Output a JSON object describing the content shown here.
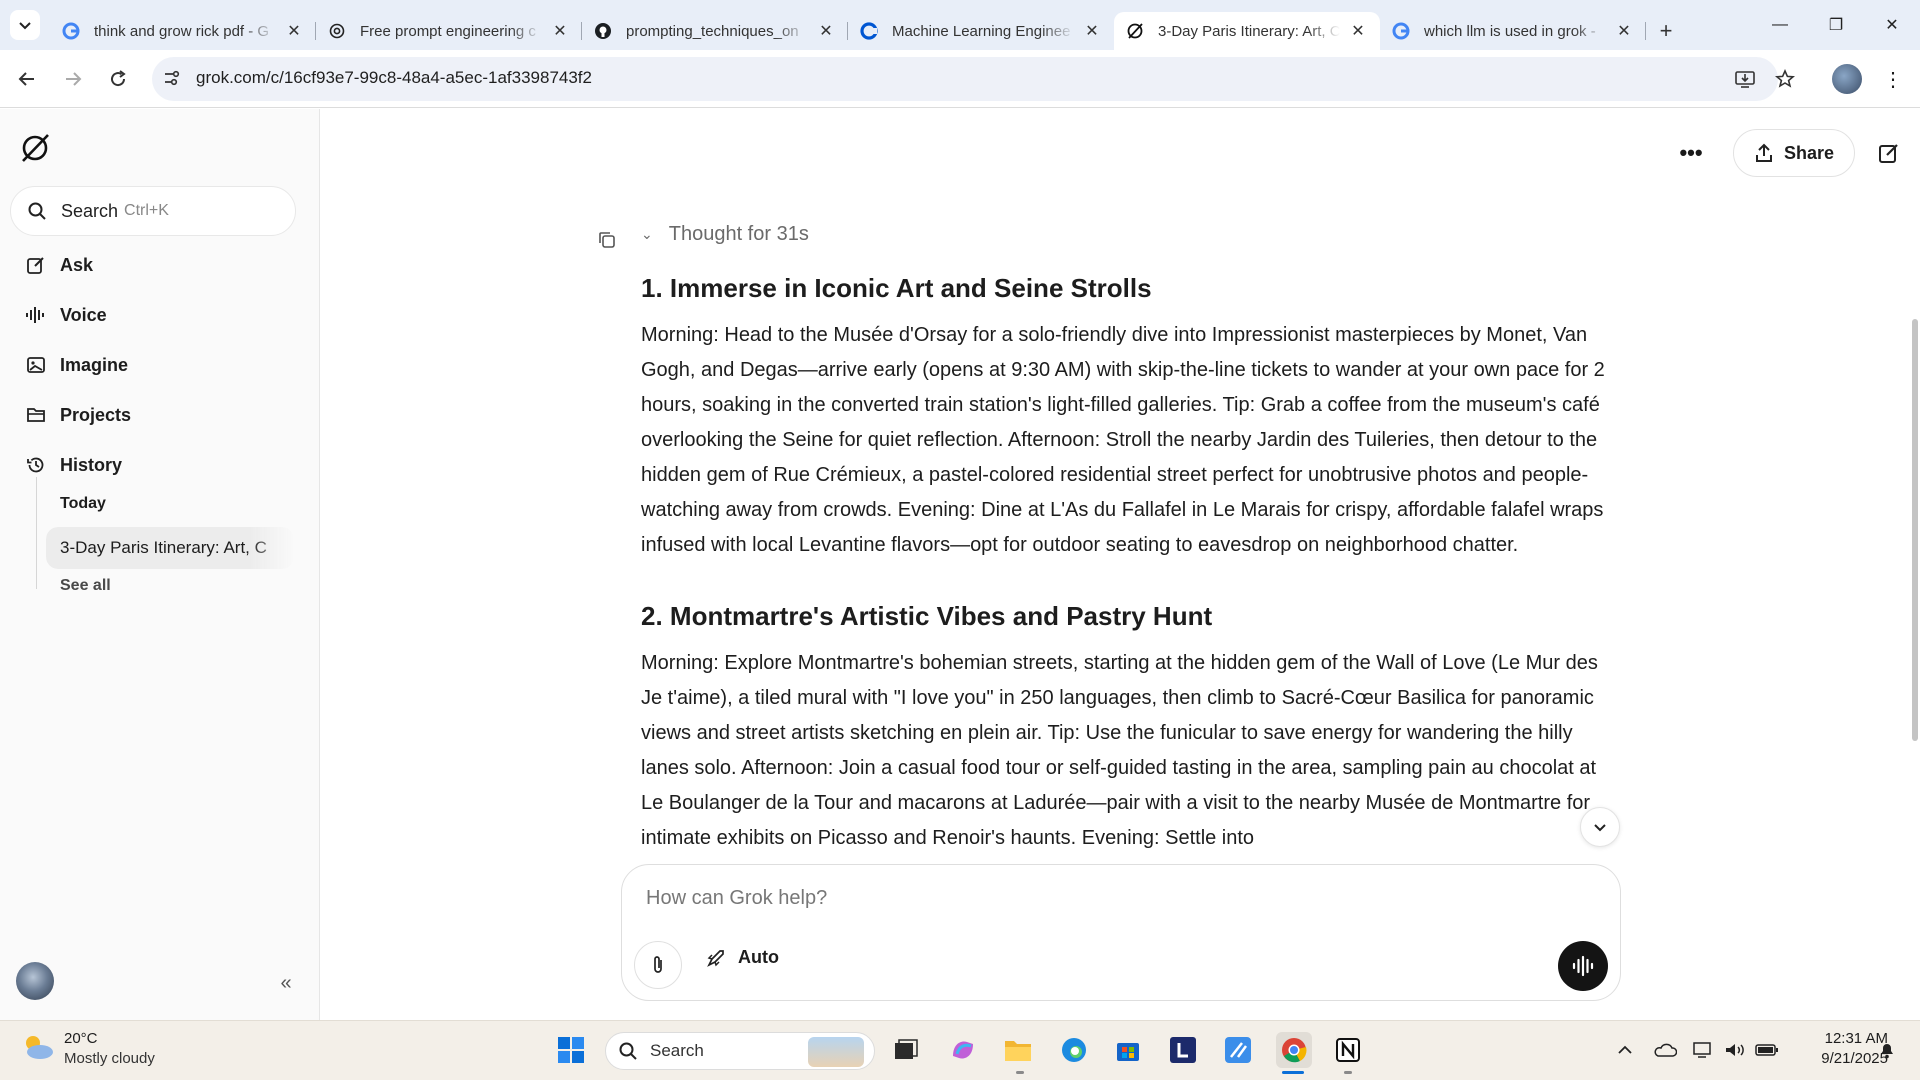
{
  "browser": {
    "tabs": [
      {
        "title": "think and grow rick pdf - G",
        "icon": "google-icon"
      },
      {
        "title": "Free prompt engineering c",
        "icon": "openai-icon"
      },
      {
        "title": "prompting_techniques_on",
        "icon": "github-icon"
      },
      {
        "title": "Machine Learning Enginee",
        "icon": "coursera-icon"
      },
      {
        "title": "3-Day Paris Itinerary: Art, C",
        "icon": "grok-icon",
        "active": true
      },
      {
        "title": "which llm is used in grok -",
        "icon": "google-icon"
      }
    ],
    "url": "grok.com/c/16cf93e7-99c8-48a4-a5ec-1af3398743f2"
  },
  "sidebar": {
    "search_label": "Search",
    "search_shortcut": "Ctrl+K",
    "nav": [
      {
        "label": "Ask",
        "icon": "pencil-icon"
      },
      {
        "label": "Voice",
        "icon": "waveform-icon"
      },
      {
        "label": "Imagine",
        "icon": "image-icon"
      },
      {
        "label": "Projects",
        "icon": "folder-icon"
      },
      {
        "label": "History",
        "icon": "history-icon"
      }
    ],
    "history_group": "Today",
    "history_item": "3-Day Paris Itinerary: Art, C",
    "see_all": "See all"
  },
  "main": {
    "share_label": "Share",
    "thought_label": "Thought for 31s",
    "sections": [
      {
        "heading": "1. Immerse in Iconic Art and Seine Strolls",
        "body": "Morning: Head to the Musée d'Orsay for a solo-friendly dive into Impressionist masterpieces by Monet, Van Gogh, and Degas—arrive early (opens at 9:30 AM) with skip-the-line tickets to wander at your own pace for 2 hours, soaking in the converted train station's light-filled galleries. Tip: Grab a coffee from the museum's café overlooking the Seine for quiet reflection. Afternoon: Stroll the nearby Jardin des Tuileries, then detour to the hidden gem of Rue Crémieux, a pastel-colored residential street perfect for unobtrusive photos and people-watching away from crowds. Evening: Dine at L'As du Fallafel in Le Marais for crispy, affordable falafel wraps infused with local Levantine flavors—opt for outdoor seating to eavesdrop on neighborhood chatter."
      },
      {
        "heading": "2. Montmartre's Artistic Vibes and Pastry Hunt",
        "body": "Morning: Explore Montmartre's bohemian streets, starting at the hidden gem of the Wall of Love (Le Mur des Je t'aime), a tiled mural with \"I love you\" in 250 languages, then climb to Sacré-Cœur Basilica for panoramic views and street artists sketching en plein air. Tip: Use the funicular to save energy for wandering the hilly lanes solo. Afternoon: Join a casual food tour or self-guided tasting in the area, sampling pain au chocolat at Le Boulanger de la Tour and macarons at Ladurée—pair with a visit to the nearby Musée de Montmartre for intimate exhibits on Picasso and Renoir's haunts. Evening: Settle into"
      }
    ],
    "composer_placeholder": "How can Grok help?",
    "mode_label": "Auto"
  },
  "taskbar": {
    "weather_temp": "20°C",
    "weather_desc": "Mostly cloudy",
    "search_label": "Search",
    "time": "12:31 AM",
    "date": "9/21/2025"
  }
}
